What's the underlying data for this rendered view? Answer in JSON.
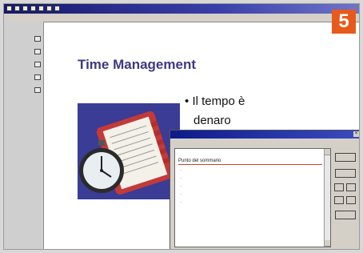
{
  "badge": "5",
  "slide": {
    "title": "Time Management",
    "bullet_marker": "•",
    "bullet_line1": "Il tempo è",
    "bullet_line2": "denaro"
  },
  "colors": {
    "badge": "#e85a1b",
    "title": "#3d3980",
    "titlebar": "#16186a",
    "clipart_bg": "#3a3c95",
    "binder": "#c23a3a"
  },
  "icons": [
    "app-icon",
    "toolbar-icon",
    "clock-stopwatch-icon",
    "planner-icon",
    "close-icon",
    "scroll-up-icon",
    "scroll-down-icon"
  ],
  "dialog": {
    "selected_item": "Punto del sommario"
  }
}
